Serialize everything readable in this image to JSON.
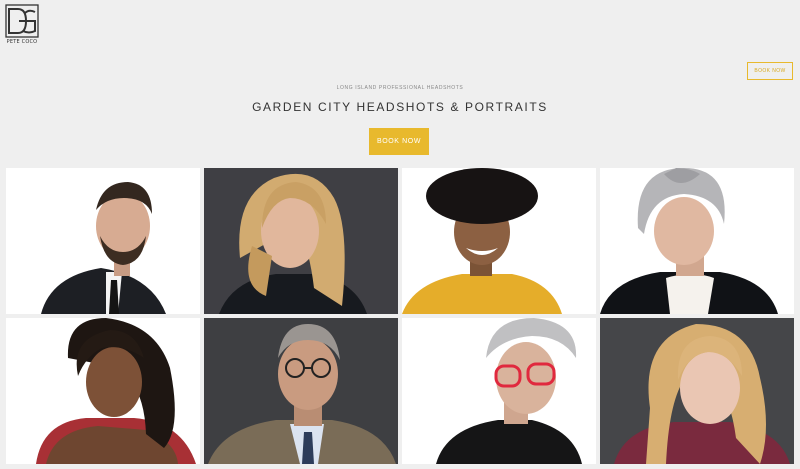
{
  "brand": {
    "logo_text": "PETE COCO",
    "accent": "#e8b92d"
  },
  "header": {
    "book_button": "BOOK NOW"
  },
  "hero": {
    "kicker": "LONG ISLAND PROFESSIONAL HEADSHOTS",
    "title": "GARDEN CITY HEADSHOTS & PORTRAITS",
    "cta_label": "BOOK NOW"
  },
  "gallery": {
    "photos": [
      {
        "subject": "man-in-dark-suit"
      },
      {
        "subject": "woman-with-blonde-hair"
      },
      {
        "subject": "man-in-yellow-shirt"
      },
      {
        "subject": "woman-in-gray-turban"
      },
      {
        "subject": "woman-with-braids"
      },
      {
        "subject": "man-with-glasses-in-suit"
      },
      {
        "subject": "woman-with-red-glasses"
      },
      {
        "subject": "woman-with-blonde-curls"
      }
    ]
  }
}
